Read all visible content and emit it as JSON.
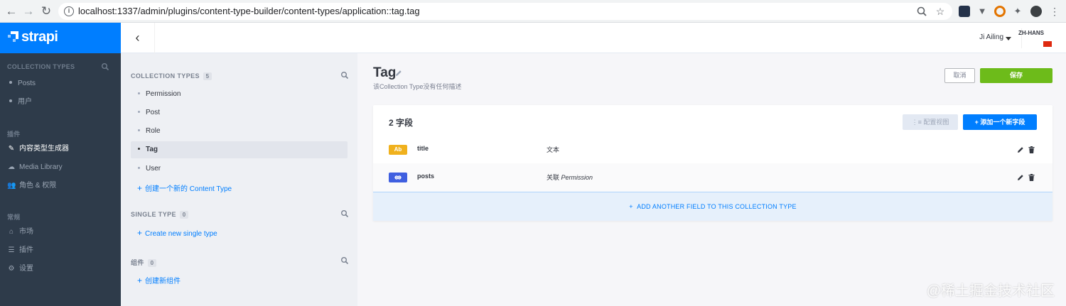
{
  "browser": {
    "url": "localhost:1337/admin/plugins/content-type-builder/content-types/application::tag.tag",
    "icons": [
      "back-arrow-icon",
      "forward-arrow-icon",
      "reload-icon",
      "info-icon",
      "zoom-icon",
      "star-icon",
      "puzzle-icon"
    ]
  },
  "brand": {
    "name": "strapi",
    "color": "#007eff"
  },
  "leftnav": {
    "collection_types_label": "COLLECTION TYPES",
    "collection_items": [
      "Posts",
      "用户"
    ],
    "plugins_label": "插件",
    "plugin_items": [
      {
        "label": "内容类型生成器",
        "icon": "brush-icon",
        "active": true
      },
      {
        "label": "Media Library",
        "icon": "cloud-icon",
        "active": false
      },
      {
        "label": "角色 & 权限",
        "icon": "users-icon",
        "active": false
      }
    ],
    "general_label": "常规",
    "general_items": [
      {
        "label": "市场",
        "icon": "store-icon"
      },
      {
        "label": "插件",
        "icon": "list-icon"
      },
      {
        "label": "设置",
        "icon": "gear-icon"
      }
    ]
  },
  "topbar": {
    "user": "Ji Ailing",
    "language": "ZH-HANS"
  },
  "ctb": {
    "collection_header": "COLLECTION TYPES",
    "collection_count": "5",
    "collection_items": [
      "Permission",
      "Post",
      "Role",
      "Tag",
      "User"
    ],
    "active_item": "Tag",
    "create_collection_link": "创建一个新的 Content Type",
    "single_header": "SINGLE TYPE",
    "single_count": "0",
    "create_single_link": "Create new single type",
    "components_header": "组件",
    "components_count": "0",
    "create_component_link": "创建新组件"
  },
  "main": {
    "title": "Tag",
    "description": "该Collection Type没有任何描述",
    "cancel_label": "取消",
    "save_label": "保存",
    "fields_count_label": "2 字段",
    "configure_label": "配置视图",
    "add_field_label": "添加一个新字段",
    "fields": [
      {
        "badge": "Ab",
        "badge_color": "#f0b11d",
        "name": "title",
        "type": "文本",
        "target": ""
      },
      {
        "badge": "🔗",
        "badge_color": "#3f5fe0",
        "name": "posts",
        "type": "关联",
        "target": "Permission"
      }
    ],
    "add_another_label": "ADD ANOTHER FIELD TO THIS COLLECTION TYPE"
  },
  "watermark": "@稀土掘金技术社区"
}
